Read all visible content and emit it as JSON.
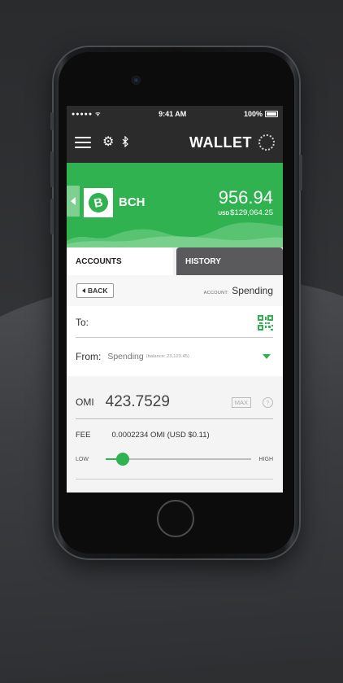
{
  "status_bar": {
    "signal": "●●●●● ᯤ",
    "time": "9:41 AM",
    "battery": "100%"
  },
  "navbar": {
    "title": "WALLET"
  },
  "balance": {
    "coin_symbol": "B",
    "coin": "BCH",
    "amount": "956.94",
    "usd_prefix": "USD",
    "usd_value": "$129,064.25"
  },
  "tabs": [
    {
      "label": "ACCOUNTS",
      "active": true
    },
    {
      "label": "HISTORY",
      "active": false
    }
  ],
  "account_bar": {
    "back_label": "BACK",
    "account_label": "ACCOUNT:",
    "account_value": "Spending"
  },
  "form": {
    "to_label": "To:",
    "to_value": "",
    "from_label": "From:",
    "from_account": "Spending",
    "from_balance": "(balance: 23,123.45)",
    "unit": "OMI",
    "amount": "423.7529",
    "max_label": "MAX",
    "help_symbol": "?",
    "fee_label": "FEE",
    "fee_value": "0.0002234 OMI  (USD $0.11)",
    "slider_low": "LOW",
    "slider_high": "HIGH",
    "slider_level": 0.12
  },
  "colors": {
    "accent": "#2fb24f",
    "dark": "#2b2b2b"
  }
}
